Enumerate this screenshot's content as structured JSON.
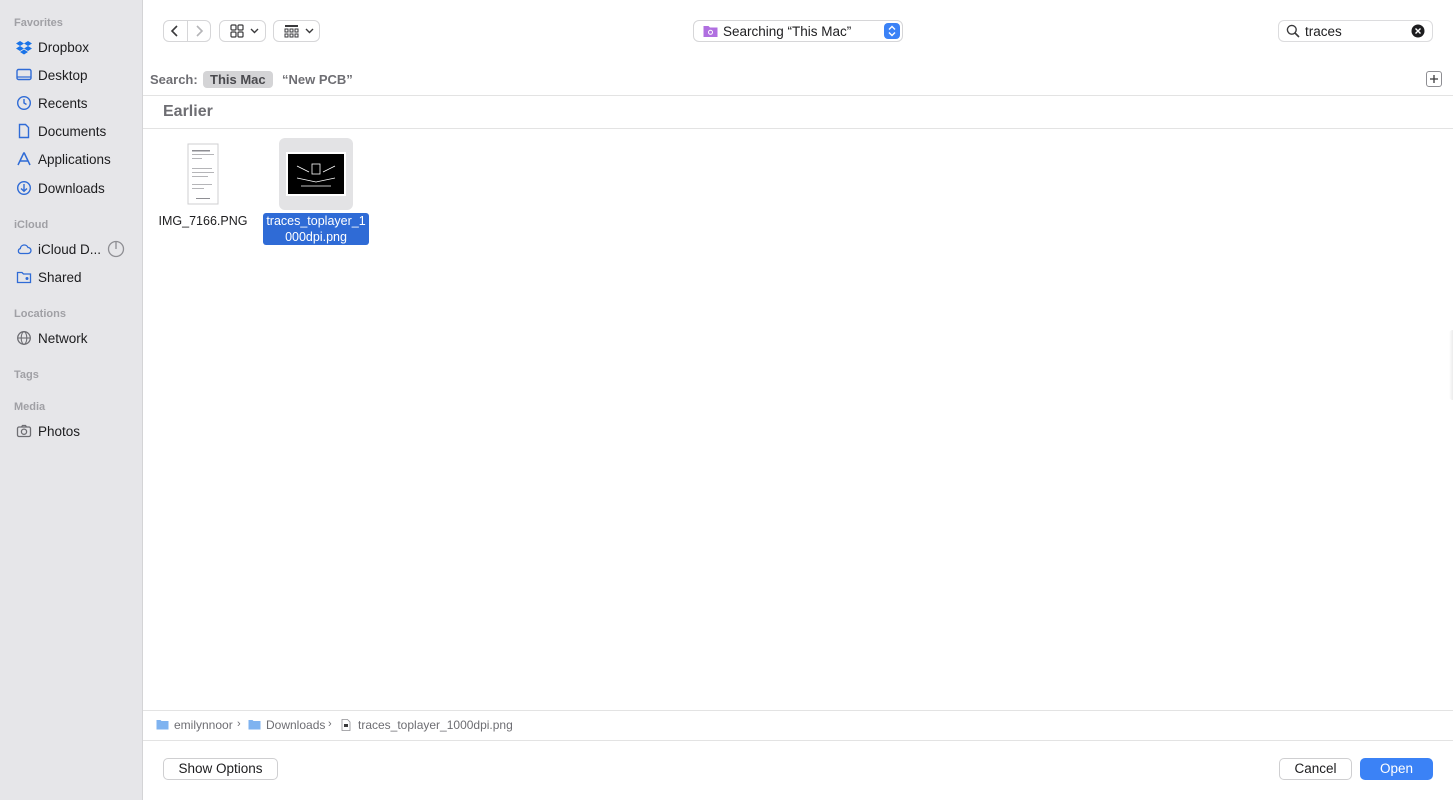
{
  "sidebar": {
    "sections": {
      "favorites": "Favorites",
      "icloud": "iCloud",
      "locations": "Locations",
      "tags": "Tags",
      "media": "Media"
    },
    "favorites": [
      {
        "label": "Dropbox",
        "icon": "dropbox-icon"
      },
      {
        "label": "Desktop",
        "icon": "desktop-icon"
      },
      {
        "label": "Recents",
        "icon": "clock-icon"
      },
      {
        "label": "Documents",
        "icon": "document-icon"
      },
      {
        "label": "Applications",
        "icon": "applications-icon"
      },
      {
        "label": "Downloads",
        "icon": "download-icon"
      }
    ],
    "icloud": [
      {
        "label": "iCloud D...",
        "icon": "cloud-icon"
      },
      {
        "label": "Shared",
        "icon": "shared-folder-icon"
      }
    ],
    "locations": [
      {
        "label": "Network",
        "icon": "globe-icon"
      }
    ],
    "media": [
      {
        "label": "Photos",
        "icon": "camera-icon"
      }
    ]
  },
  "toolbar": {
    "scope_title": "Searching “This Mac”",
    "search_value": "traces"
  },
  "scopebar": {
    "label": "Search:",
    "active_scope": "This Mac",
    "other_scope": "“New PCB”"
  },
  "results": {
    "group_title": "Earlier",
    "files": [
      {
        "name": "IMG_7166.PNG",
        "selected": false
      },
      {
        "name": "traces_toplayer_1000dpi.png",
        "selected": true
      }
    ]
  },
  "pathbar": {
    "segments": [
      "emilynnoor",
      "Downloads",
      "traces_toplayer_1000dpi.png"
    ]
  },
  "buttons": {
    "show_options": "Show Options",
    "cancel": "Cancel",
    "open": "Open"
  },
  "colors": {
    "accent": "#3b82f6",
    "selection": "#2f6bd6",
    "sidebar_bg": "#e6e6e9"
  }
}
